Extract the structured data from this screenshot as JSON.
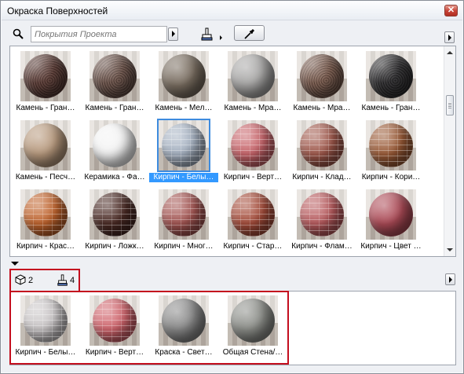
{
  "window": {
    "title": "Окраска Поверхностей",
    "close_glyph": "✕"
  },
  "toolbar": {
    "search_placeholder": "Покрытия Проекта",
    "icons": [
      "search-icon",
      "paint-brush-icon",
      "eyedropper-icon",
      "play-arrow-icon"
    ]
  },
  "materials": [
    {
      "label": "Камень - Гран…",
      "color": "#5a3a33",
      "pattern": "speckle"
    },
    {
      "label": "Камень - Гран…",
      "color": "#6b5148",
      "pattern": "speckle"
    },
    {
      "label": "Камень - Мел…",
      "color": "#7a6e61",
      "pattern": "plain"
    },
    {
      "label": "Камень - Мра…",
      "color": "#a8a7a6",
      "pattern": "plain"
    },
    {
      "label": "Камень - Мра…",
      "color": "#7a5a4c",
      "pattern": "speckle"
    },
    {
      "label": "Камень - Гран…",
      "color": "#2b2a2c",
      "pattern": "speckle"
    },
    {
      "label": "Камень - Песч…",
      "color": "#b89a7e",
      "pattern": "plain"
    },
    {
      "label": "Керамика - Фа…",
      "color": "#f4f4f4",
      "pattern": "plain"
    },
    {
      "label": "Кирпич - Белы…",
      "color": "#a7b3c3",
      "pattern": "brick"
    },
    {
      "label": "Кирпич - Верт…",
      "color": "#c8646a",
      "pattern": "brick"
    },
    {
      "label": "Кирпич - Клад…",
      "color": "#a0584b",
      "pattern": "brick"
    },
    {
      "label": "Кирпич - Кори…",
      "color": "#9a5a36",
      "pattern": "brick"
    },
    {
      "label": "Кирпич - Крас…",
      "color": "#c0632c",
      "pattern": "brick"
    },
    {
      "label": "Кирпич - Ложк…",
      "color": "#4a2a24",
      "pattern": "brick"
    },
    {
      "label": "Кирпич - Мног…",
      "color": "#a45552",
      "pattern": "brick"
    },
    {
      "label": "Кирпич - Стар…",
      "color": "#a54c3a",
      "pattern": "brick"
    },
    {
      "label": "Кирпич - Флам…",
      "color": "#b85a5d",
      "pattern": "brick"
    },
    {
      "label": "Кирпич - Цвет …",
      "color": "#ad4b57",
      "pattern": "plain"
    }
  ],
  "selected_index": 8,
  "counts": {
    "objects": "2",
    "surfaces": "4"
  },
  "used_materials": [
    {
      "label": "Кирпич - Белы…",
      "color": "#c9c5c6",
      "pattern": "brick"
    },
    {
      "label": "Кирпич - Верт…",
      "color": "#d0646c",
      "pattern": "brick"
    },
    {
      "label": "Краска - Свет…",
      "color": "#8a8a8a",
      "pattern": "plain"
    },
    {
      "label": "Общая Стена/…",
      "color": "#8d8f8a",
      "pattern": "plain"
    }
  ]
}
